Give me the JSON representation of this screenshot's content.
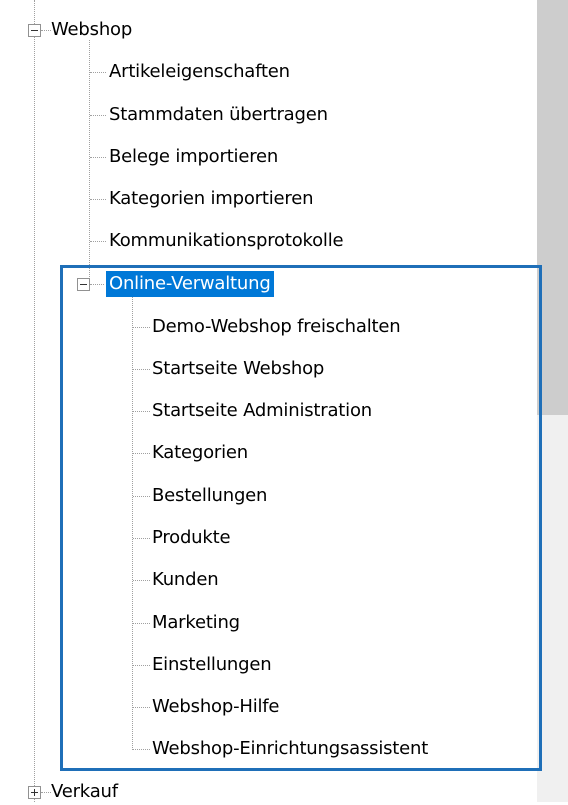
{
  "tree": {
    "webshop": {
      "label": "Webshop",
      "children": [
        "Artikeleigenschaften",
        "Stammdaten übertragen",
        "Belege importieren",
        "Kategorien importieren",
        "Kommunikationsprotokolle"
      ]
    },
    "online": {
      "label": "Online-Verwaltung",
      "children": [
        "Demo-Webshop freischalten",
        "Startseite Webshop",
        "Startseite Administration",
        "Kategorien",
        "Bestellungen",
        "Produkte",
        "Kunden",
        "Marketing",
        "Einstellungen",
        "Webshop-Hilfe",
        "Webshop-Einrichtungsassistent"
      ]
    },
    "verkauf": {
      "label": "Verkauf"
    }
  },
  "colors": {
    "selection": "#0078d7",
    "highlight_border": "#1f6fb8"
  }
}
